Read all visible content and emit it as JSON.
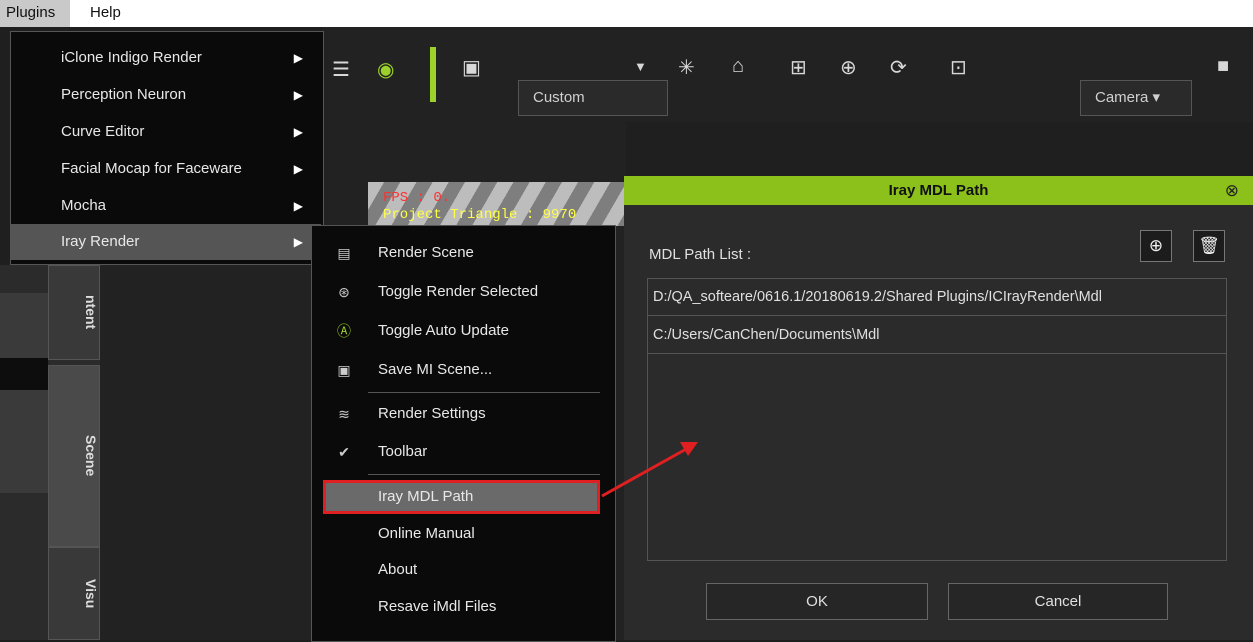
{
  "menubar": {
    "plugins": "Plugins",
    "help": "Help"
  },
  "toolbar": {
    "view_combo": "Custom",
    "camera_combo": "Camera"
  },
  "viewport": {
    "fps": "FPS : 0.",
    "project_triangle": "Project Triangle : 9970"
  },
  "side_tabs": {
    "content": "ntent",
    "scene": "Scene",
    "visual": "Visu"
  },
  "plugin_menu": {
    "items": [
      {
        "label": "iClone Indigo Render"
      },
      {
        "label": "Perception Neuron"
      },
      {
        "label": "Curve Editor"
      },
      {
        "label": "Facial Mocap for Faceware"
      },
      {
        "label": "Mocha"
      },
      {
        "label": "Iray Render"
      }
    ]
  },
  "submenu": {
    "items": [
      {
        "label": "Render Scene",
        "icon": "render-scene-icon"
      },
      {
        "label": "Toggle Render Selected",
        "icon": "render-selected-icon"
      },
      {
        "label": "Toggle Auto Update",
        "icon": "auto-update-icon"
      },
      {
        "label": "Save MI Scene...",
        "icon": "save-icon"
      },
      {
        "label": "Render Settings",
        "icon": "settings-icon"
      },
      {
        "label": "Toolbar",
        "icon": "checkmark-icon"
      },
      {
        "label": "Iray MDL Path"
      },
      {
        "label": "Online Manual"
      },
      {
        "label": "About"
      },
      {
        "label": "Resave iMdl Files"
      }
    ]
  },
  "dialog": {
    "title": "Iray MDL Path",
    "list_label": "MDL Path List :",
    "paths": [
      "D:/QA_softeare/0616.1/20180619.2/Shared Plugins/ICIrayRender\\Mdl",
      "C:/Users/CanChen/Documents\\Mdl"
    ],
    "ok": "OK",
    "cancel": "Cancel",
    "accent_color": "#8bc11a"
  },
  "annotation_color": "#e02020"
}
